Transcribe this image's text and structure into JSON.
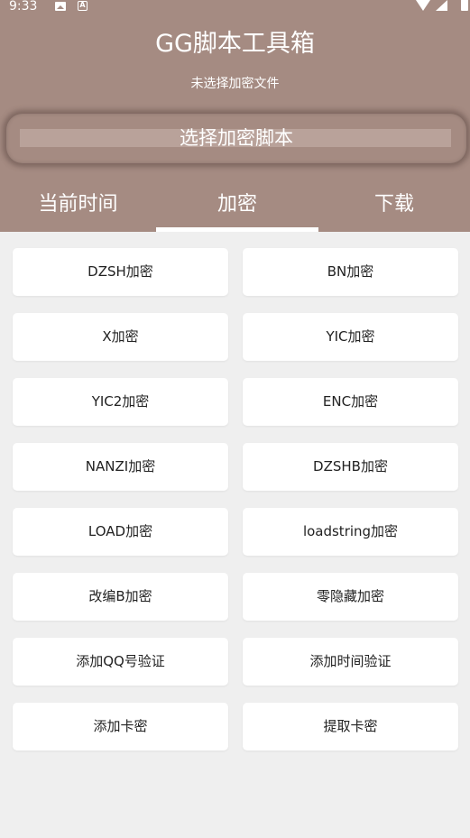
{
  "status_bar": {
    "time": "9:33",
    "icons": [
      "image-icon",
      "a-icon",
      "wifi-icon",
      "signal-icon",
      "battery-icon"
    ]
  },
  "header": {
    "title": "GG脚本工具箱",
    "subtitle": "未选择加密文件",
    "select_button": "选择加密脚本",
    "background": "#a58b82"
  },
  "tabs": [
    {
      "label": "当前时间",
      "selected": false
    },
    {
      "label": "加密",
      "selected": true
    },
    {
      "label": "下载",
      "selected": false
    }
  ],
  "buttons": [
    {
      "label": "DZSH加密"
    },
    {
      "label": "BN加密"
    },
    {
      "label": "X加密"
    },
    {
      "label": "YIC加密"
    },
    {
      "label": "YIC2加密"
    },
    {
      "label": "ENC加密"
    },
    {
      "label": "NANZI加密"
    },
    {
      "label": "DZSHB加密"
    },
    {
      "label": "LOAD加密"
    },
    {
      "label": "loadstring加密"
    },
    {
      "label": "改编B加密"
    },
    {
      "label": "零隐藏加密"
    },
    {
      "label": "添加QQ号验证"
    },
    {
      "label": "添加时间验证"
    },
    {
      "label": "添加卡密"
    },
    {
      "label": "提取卡密"
    }
  ]
}
